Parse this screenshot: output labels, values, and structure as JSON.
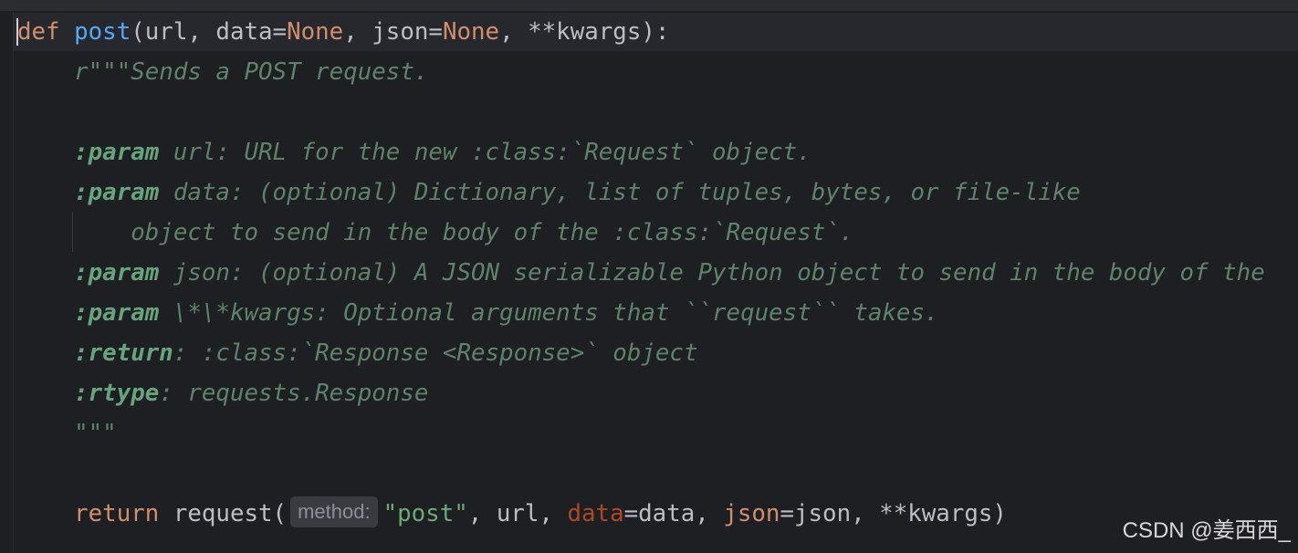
{
  "editor": {
    "lines": {
      "l1": {
        "def": "def",
        "fname": "post",
        "open": "(url, data=",
        "none1": "None",
        "mid": ", json=",
        "none2": "None",
        "close": ", **kwargs):"
      },
      "l2": {
        "text": "    r\"\"\"Sends a POST request."
      },
      "l3": {
        "text": ""
      },
      "l4": {
        "tag": "    :param",
        "text": " url: URL for the new :class:`Request` object."
      },
      "l5": {
        "tag": "    :param",
        "text": " data: (optional) Dictionary, list of tuples, bytes, or file-like"
      },
      "l6": {
        "text": "        object to send in the body of the :class:`Request`."
      },
      "l7": {
        "tag": "    :param",
        "text": " json: (optional) A JSON serializable Python object to send in the body of the"
      },
      "l8": {
        "tag": "    :param",
        "text": " \\*\\*kwargs: Optional arguments that ``request`` takes."
      },
      "l9": {
        "tag": "    :return",
        "text": ": :class:`Response <Response>` object"
      },
      "l10": {
        "tag": "    :rtype",
        "text": ": requests.Response"
      },
      "l11": {
        "text": "    \"\"\""
      },
      "l12": {
        "text": ""
      },
      "l13": {
        "indent": "    ",
        "ret": "return",
        "call": " request(",
        "hint": "method:",
        "str": "\"post\"",
        "a1": ", url, ",
        "k1": "data",
        "a2": "=data, ",
        "k2": "json",
        "a3": "=json, **kwargs)"
      }
    }
  },
  "watermark": "CSDN @姜西西_",
  "colors": {
    "background": "#1e1f22",
    "keyword": "#cf8e6d",
    "function": "#56a8f5",
    "docstring": "#5f826b",
    "string": "#6aab73",
    "kwarg_param": "#aa4926"
  }
}
